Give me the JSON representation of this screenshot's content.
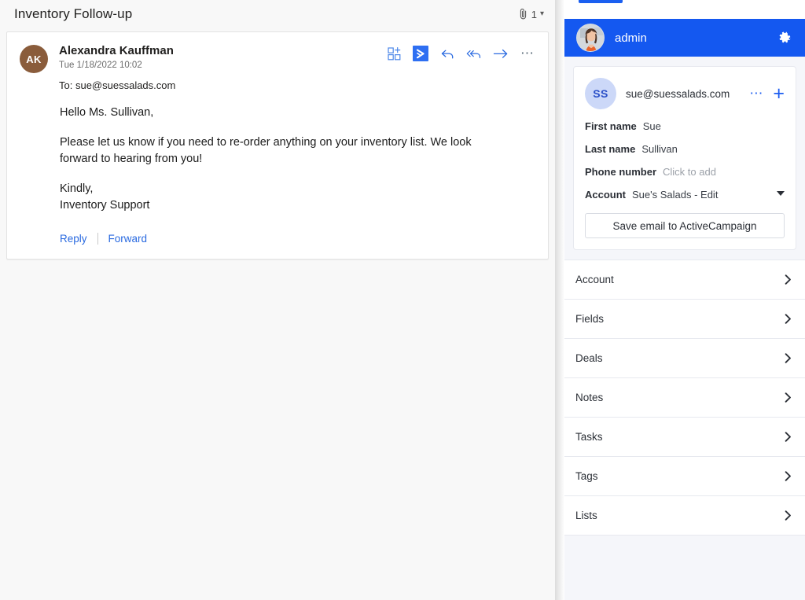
{
  "mail": {
    "subject": "Inventory Follow-up",
    "attachment_count": "1",
    "attachment_icon": "paperclip-icon",
    "expand_icon": "chevron-down-icon",
    "sender": {
      "initials": "AK",
      "name": "Alexandra Kauffman",
      "date": "Tue 1/18/2022 10:02",
      "to_label": "To:",
      "to_value": "sue@suessalads.com"
    },
    "actions": [
      {
        "name": "add-to-grid-icon",
        "title": "Add"
      },
      {
        "name": "activecampaign-icon",
        "title": "ActiveCampaign"
      },
      {
        "name": "reply-icon",
        "title": "Reply"
      },
      {
        "name": "reply-all-icon",
        "title": "Reply all"
      },
      {
        "name": "forward-icon",
        "title": "Forward"
      },
      {
        "name": "more-options-icon",
        "title": "More actions"
      }
    ],
    "body": [
      "Hello Ms. Sullivan,",
      "Please let us know if you need to re-order anything on your inventory list. We look forward to hearing from you!",
      "Kindly,\nInventory Support"
    ],
    "body_paragraphs": {
      "greeting": "Hello Ms. Sullivan,",
      "message": "Please let us know if you need to re-order anything on your inventory list. We look forward to hearing from you!",
      "signoff_line1": "Kindly,",
      "signoff_line2": "Inventory Support"
    },
    "reply_label": "Reply",
    "forward_label": "Forward"
  },
  "panel": {
    "header": {
      "username": "admin",
      "avatar_icon": "user-photo-avatar",
      "settings_icon": "gear-icon"
    },
    "contact": {
      "initials": "SS",
      "email": "sue@suessalads.com",
      "more_icon": "more-options-icon",
      "add_icon": "plus-icon",
      "fields": [
        {
          "label": "First name",
          "value": "Sue",
          "muted": false
        },
        {
          "label": "Last name",
          "value": "Sullivan",
          "muted": false
        },
        {
          "label": "Phone number",
          "value": "Click to add",
          "muted": true
        }
      ],
      "account": {
        "label": "Account",
        "value": "Sue's Salads - Edit",
        "caret_icon": "caret-down-icon"
      },
      "save_button": "Save email to ActiveCampaign"
    },
    "list": [
      {
        "label": "Account",
        "chevron": "chevron-right-icon"
      },
      {
        "label": "Fields",
        "chevron": "chevron-right-icon"
      },
      {
        "label": "Deals",
        "chevron": "chevron-right-icon"
      },
      {
        "label": "Notes",
        "chevron": "chevron-right-icon"
      },
      {
        "label": "Tasks",
        "chevron": "chevron-right-icon"
      },
      {
        "label": "Tags",
        "chevron": "chevron-right-icon"
      },
      {
        "label": "Lists",
        "chevron": "chevron-right-icon"
      }
    ]
  },
  "colors": {
    "brand_blue": "#1458f0",
    "link_blue": "#2a6ae0",
    "sender_avatar": "#8a5c3b",
    "contact_avatar_bg": "#ccd8f8",
    "contact_avatar_fg": "#2b50c8",
    "panel_bg": "#f5f6fa"
  }
}
